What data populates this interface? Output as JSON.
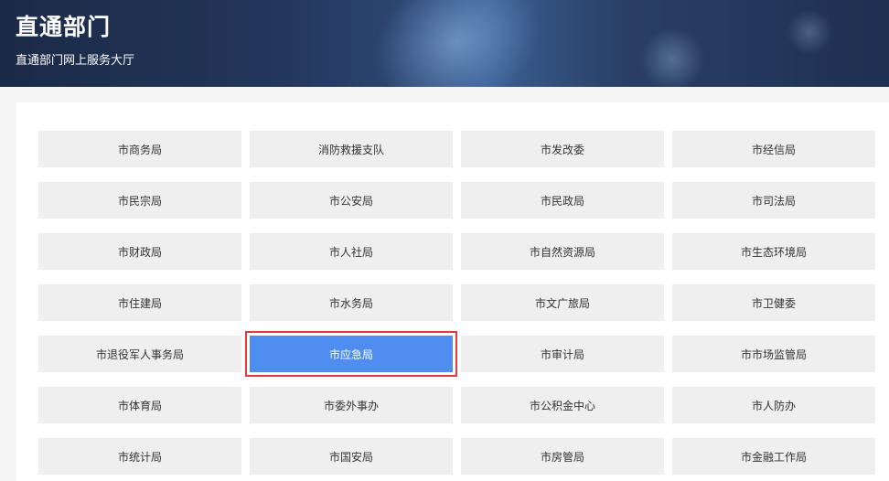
{
  "header": {
    "title": "直通部门",
    "subtitle": "直通部门网上服务大厅"
  },
  "departments": [
    {
      "label": "市商务局",
      "selected": false
    },
    {
      "label": "消防救援支队",
      "selected": false
    },
    {
      "label": "市发改委",
      "selected": false
    },
    {
      "label": "市经信局",
      "selected": false
    },
    {
      "label": "市民宗局",
      "selected": false
    },
    {
      "label": "市公安局",
      "selected": false
    },
    {
      "label": "市民政局",
      "selected": false
    },
    {
      "label": "市司法局",
      "selected": false
    },
    {
      "label": "市财政局",
      "selected": false
    },
    {
      "label": "市人社局",
      "selected": false
    },
    {
      "label": "市自然资源局",
      "selected": false
    },
    {
      "label": "市生态环境局",
      "selected": false
    },
    {
      "label": "市住建局",
      "selected": false
    },
    {
      "label": "市水务局",
      "selected": false
    },
    {
      "label": "市文广旅局",
      "selected": false
    },
    {
      "label": "市卫健委",
      "selected": false
    },
    {
      "label": "市退役军人事务局",
      "selected": false
    },
    {
      "label": "市应急局",
      "selected": true
    },
    {
      "label": "市审计局",
      "selected": false
    },
    {
      "label": "市市场监管局",
      "selected": false
    },
    {
      "label": "市体育局",
      "selected": false
    },
    {
      "label": "市委外事办",
      "selected": false
    },
    {
      "label": "市公积金中心",
      "selected": false
    },
    {
      "label": "市人防办",
      "selected": false
    },
    {
      "label": "市统计局",
      "selected": false
    },
    {
      "label": "市国安局",
      "selected": false
    },
    {
      "label": "市房管局",
      "selected": false
    },
    {
      "label": "市金融工作局",
      "selected": false
    }
  ],
  "colors": {
    "selected_bg": "#4f8ef0",
    "selected_outline": "#e0383e",
    "tile_bg": "#efefef"
  }
}
